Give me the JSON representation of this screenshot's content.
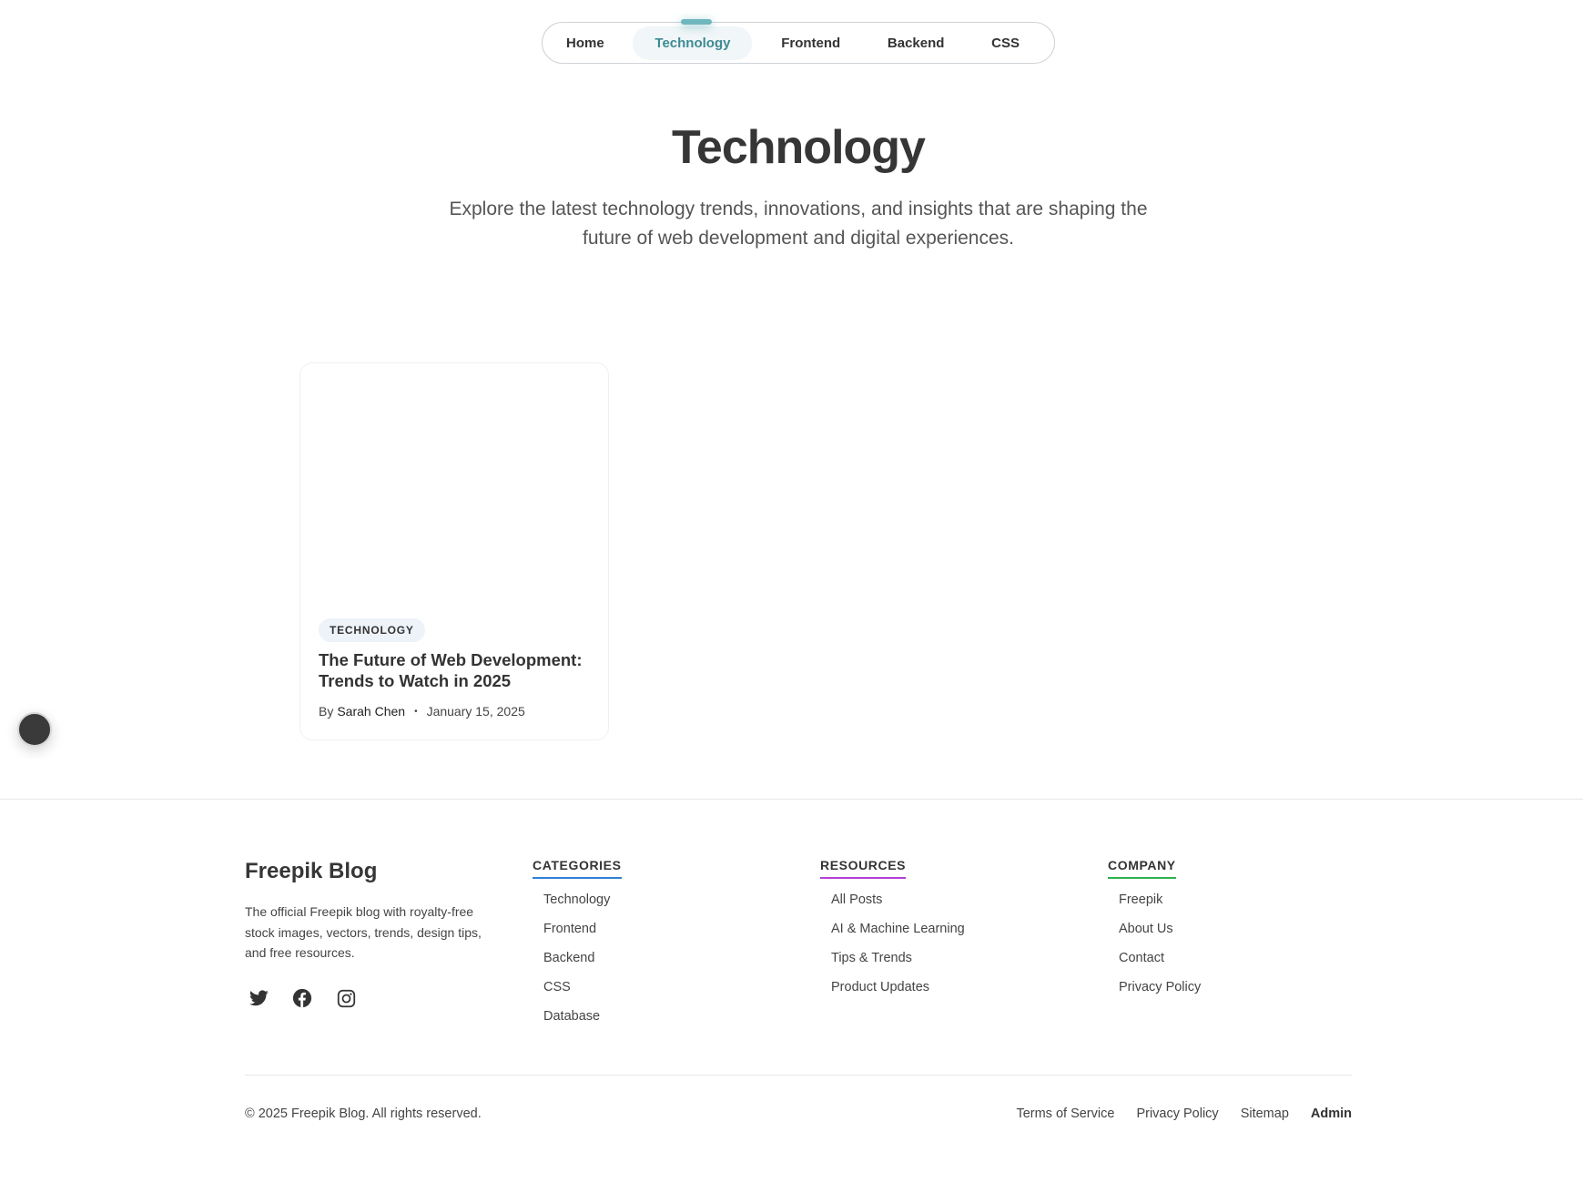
{
  "nav": {
    "items": [
      {
        "label": "Home"
      },
      {
        "label": "Technology"
      },
      {
        "label": "Frontend"
      },
      {
        "label": "Backend"
      },
      {
        "label": "CSS"
      }
    ],
    "active_index": 1,
    "accent_color": "#3d8a93"
  },
  "hero": {
    "title": "Technology",
    "subtitle": "Explore the latest technology trends, innovations, and insights that are shaping the future of web development and digital experiences."
  },
  "posts": [
    {
      "category": "TECHNOLOGY",
      "title": "The Future of Web Development: Trends to Watch in 2025",
      "by_prefix": "By",
      "author": "Sarah Chen",
      "separator": "•",
      "date": "January 15, 2025"
    }
  ],
  "footer": {
    "brand": "Freepik Blog",
    "description": "The official Freepik blog with royalty-free stock images, vectors, trends, design tips, and free resources.",
    "socials": [
      "twitter-icon",
      "facebook-icon",
      "instagram-icon"
    ],
    "columns": [
      {
        "heading": "CATEGORIES",
        "underline_color": "#2f7fd6",
        "links": [
          "Technology",
          "Frontend",
          "Backend",
          "CSS",
          "Database"
        ]
      },
      {
        "heading": "RESOURCES",
        "underline_color": "#b43fd6",
        "links": [
          "All Posts",
          "AI & Machine Learning",
          "Tips & Trends",
          "Product Updates"
        ]
      },
      {
        "heading": "COMPANY",
        "underline_color": "#2fb14f",
        "links": [
          "Freepik",
          "About Us",
          "Contact",
          "Privacy Policy"
        ]
      }
    ],
    "copyright": "© 2025 Freepik Blog. All rights reserved.",
    "legal_links": [
      "Terms of Service",
      "Privacy Policy",
      "Sitemap",
      "Admin"
    ]
  }
}
